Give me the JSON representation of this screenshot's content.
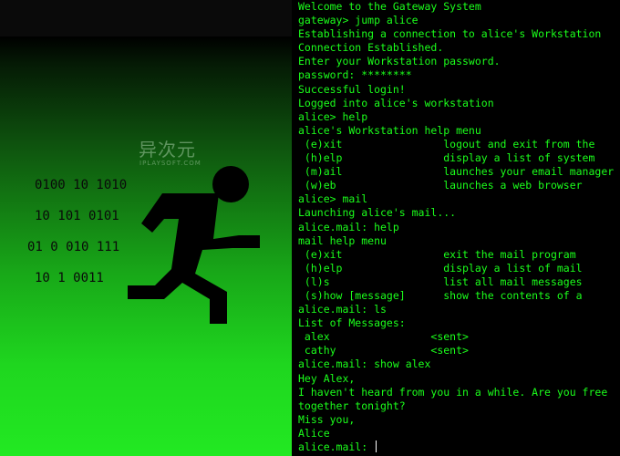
{
  "binary_art": [
    "0100 10 1010",
    "10 101 0101",
    "01 0 010 111",
    "10 1 0011"
  ],
  "watermark": {
    "logo_text": "异次元",
    "site_text": "IPLAYSOFT.COM"
  },
  "terminal": {
    "lines": [
      "Welcome to the Gateway System",
      "gateway> jump alice",
      "Establishing a connection to alice's Workstation",
      "Connection Established.",
      "Enter your Workstation password.",
      "password: ********",
      "Successful login!",
      "Logged into alice's workstation",
      "alice> help",
      "alice's Workstation help menu",
      " (e)xit                logout and exit from the",
      " (h)elp                display a list of system",
      " (m)ail                launches your email manager",
      " (w)eb                 launches a web browser",
      "alice> mail",
      "Launching alice's mail...",
      "alice.mail: help",
      "mail help menu",
      " (e)xit                exit the mail program",
      " (h)elp                display a list of mail",
      " (l)s                  list all mail messages",
      " (s)how [message]      show the contents of a",
      "alice.mail: ls",
      "List of Messages:",
      " alex                <sent>",
      " cathy               <sent>",
      "alice.mail: show alex",
      "Hey Alex,",
      "I haven't heard from you in a while. Are you free",
      "together tonight?",
      "Miss you,",
      "Alice"
    ],
    "prompt": "alice.mail: ",
    "input_value": ""
  },
  "colors": {
    "terminal_text": "#1bff1b",
    "terminal_bg": "#000000",
    "runner": "#000000",
    "gradient_bottom": "#22e922"
  },
  "icons": {
    "runner": "running-man-icon",
    "cursor": "text-cursor"
  }
}
